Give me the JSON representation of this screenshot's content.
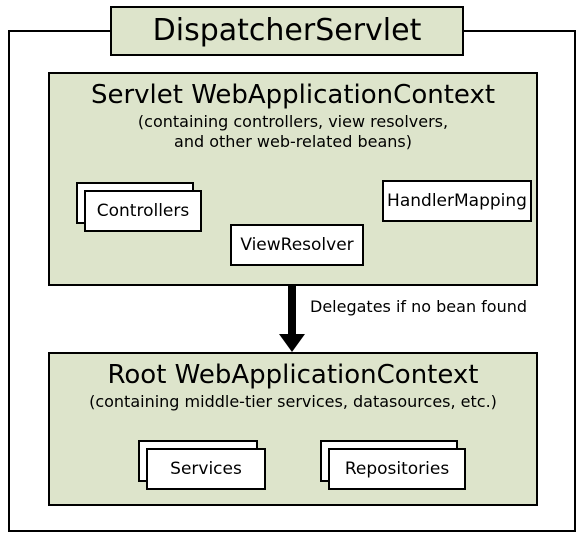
{
  "title": "DispatcherServlet",
  "servlet_context": {
    "title": "Servlet WebApplicationContext",
    "subtitle_line1": "(containing controllers, view resolvers,",
    "subtitle_line2": "and other web-related beans)",
    "components": {
      "controllers": "Controllers",
      "view_resolver": "ViewResolver",
      "handler_mapping": "HandlerMapping"
    }
  },
  "arrow_label": "Delegates if no bean found",
  "root_context": {
    "title": "Root WebApplicationContext",
    "subtitle": "(containing middle-tier services, datasources, etc.)",
    "components": {
      "services": "Services",
      "repositories": "Repositories"
    }
  }
}
